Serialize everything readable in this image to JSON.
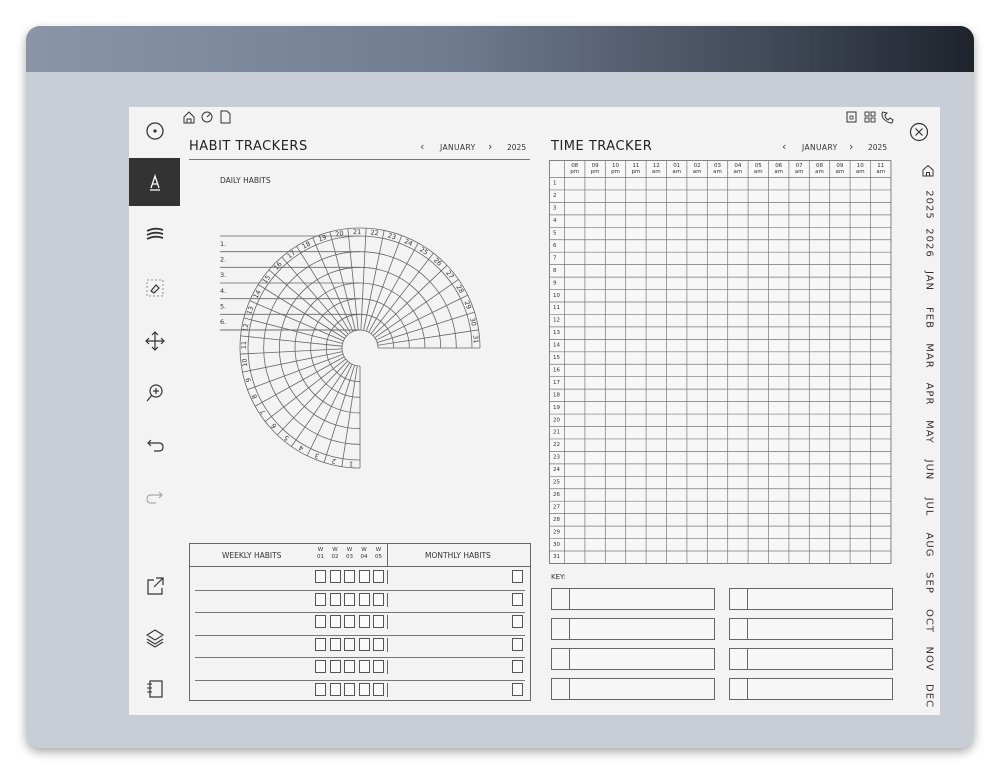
{
  "habit": {
    "title": "HABIT TRACKERS",
    "month": "JANUARY",
    "year": "2025",
    "daily_label": "DAILY HABITS",
    "daily_numbers": [
      "1.",
      "2.",
      "3.",
      "4.",
      "5.",
      "6."
    ],
    "days": [
      "1",
      "2",
      "3",
      "4",
      "5",
      "6",
      "7",
      "8",
      "9",
      "10",
      "11",
      "12",
      "13",
      "14",
      "15",
      "16",
      "17",
      "18",
      "19",
      "20",
      "21",
      "22",
      "23",
      "24",
      "25",
      "26",
      "27",
      "28",
      "29",
      "30",
      "31"
    ],
    "weekly_label": "WEEKLY HABITS",
    "week_cols": [
      [
        "W",
        "01"
      ],
      [
        "W",
        "02"
      ],
      [
        "W",
        "03"
      ],
      [
        "W",
        "04"
      ],
      [
        "W",
        "05"
      ]
    ],
    "monthly_label": "MONTHLY HABITS"
  },
  "time": {
    "title": "TIME TRACKER",
    "month": "JANUARY",
    "year": "2025",
    "hours": [
      [
        "08",
        "pm"
      ],
      [
        "09",
        "pm"
      ],
      [
        "10",
        "pm"
      ],
      [
        "11",
        "pm"
      ],
      [
        "12",
        "am"
      ],
      [
        "01",
        "am"
      ],
      [
        "02",
        "am"
      ],
      [
        "03",
        "am"
      ],
      [
        "04",
        "am"
      ],
      [
        "05",
        "am"
      ],
      [
        "06",
        "am"
      ],
      [
        "07",
        "am"
      ],
      [
        "08",
        "am"
      ],
      [
        "09",
        "am"
      ],
      [
        "10",
        "am"
      ],
      [
        "11",
        "am"
      ]
    ],
    "key_label": "KEY:"
  },
  "sidebar": [
    "2025",
    "2026",
    "JAN",
    "FEB",
    "MAR",
    "APR",
    "MAY",
    "JUN",
    "JUL",
    "AUG",
    "SEP",
    "OCT",
    "NOV",
    "DEC"
  ],
  "icons": {
    "toolbar": [
      "menu-icon",
      "pen-icon",
      "marker-icon",
      "eraser-icon",
      "move-icon",
      "zoom-icon",
      "undo-icon",
      "redo-icon",
      "share-icon",
      "layers-icon",
      "notebook-icon"
    ],
    "header_left": [
      "home-icon",
      "sync-icon",
      "page-icon"
    ],
    "header_right": [
      "calendar-icon",
      "template-icon",
      "phone-icon"
    ]
  }
}
